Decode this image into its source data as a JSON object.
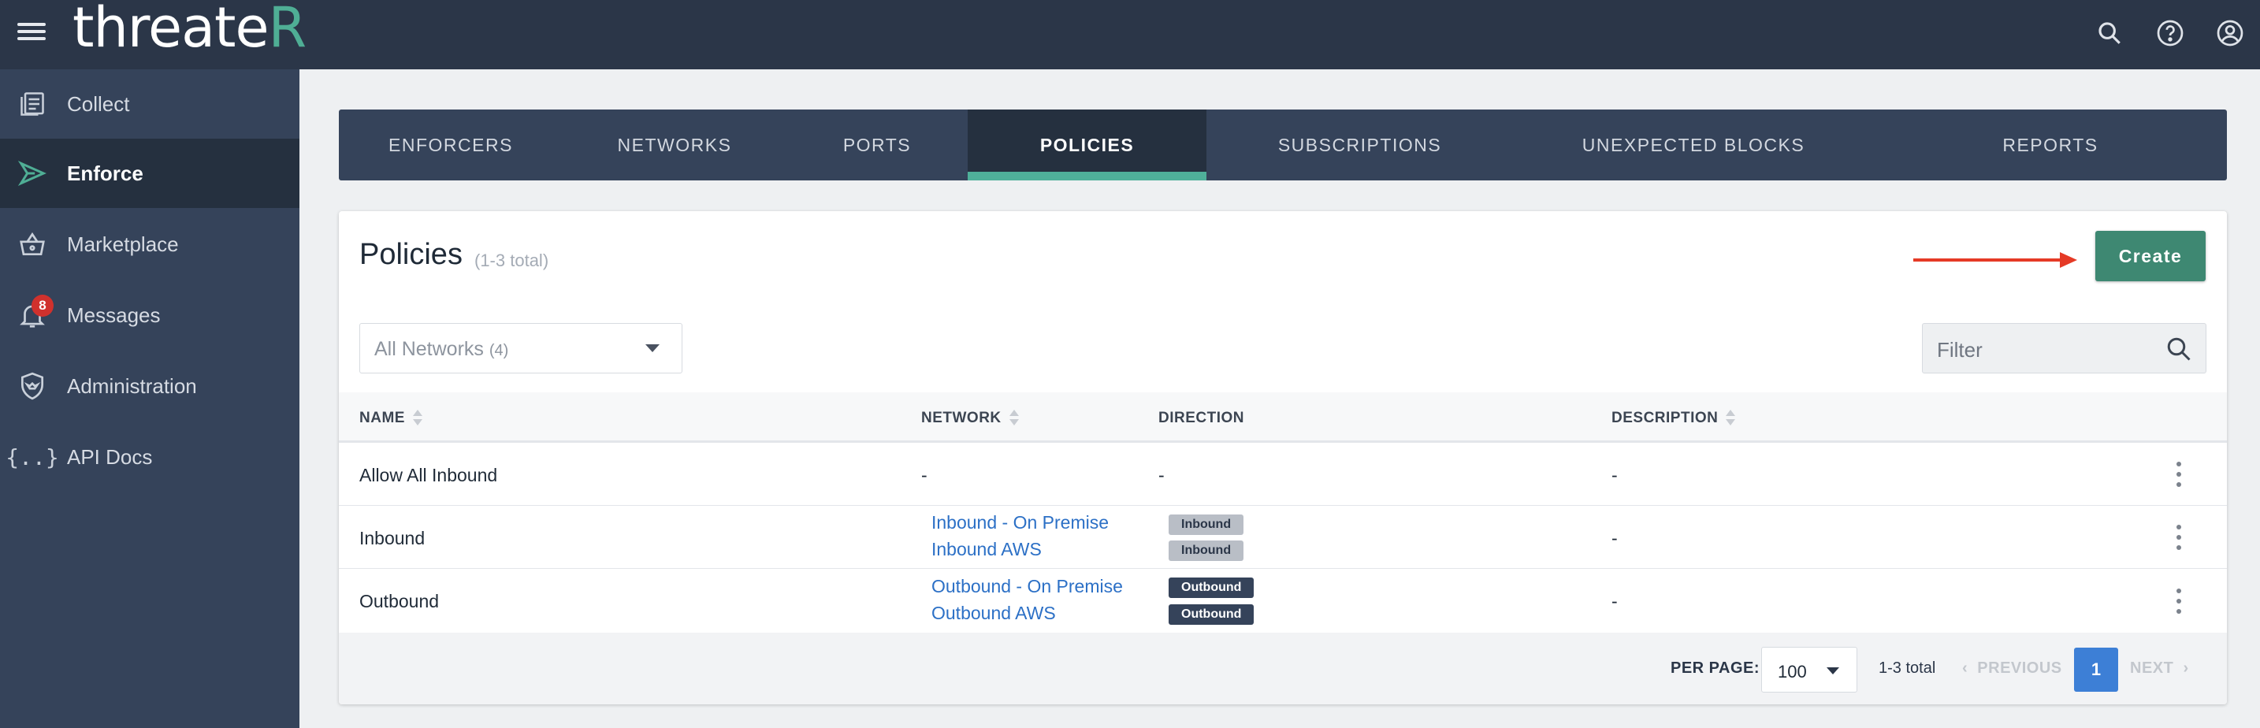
{
  "app": {
    "brand_prefix": "threate",
    "brand_suffix": "R",
    "brand_accent_color": "#4fae95",
    "header_icons": [
      "search-icon",
      "help-icon",
      "account-icon"
    ]
  },
  "sidebar": {
    "items": [
      {
        "label": "Collect",
        "icon": "collect-icon",
        "active": false
      },
      {
        "label": "Enforce",
        "icon": "enforce-icon",
        "active": true
      },
      {
        "label": "Marketplace",
        "icon": "basket-icon",
        "active": false
      },
      {
        "label": "Messages",
        "icon": "bell-icon",
        "active": false,
        "badge": "8"
      },
      {
        "label": "Administration",
        "icon": "shield-icon",
        "active": false
      },
      {
        "label": "API Docs",
        "icon": "braces-icon",
        "active": false
      }
    ]
  },
  "tabs": [
    {
      "label": "ENFORCERS",
      "active": false
    },
    {
      "label": "NETWORKS",
      "active": false
    },
    {
      "label": "PORTS",
      "active": false
    },
    {
      "label": "POLICIES",
      "active": true
    },
    {
      "label": "SUBSCRIPTIONS",
      "active": false
    },
    {
      "label": "UNEXPECTED BLOCKS",
      "active": false
    },
    {
      "label": "REPORTS",
      "active": false
    }
  ],
  "card": {
    "title": "Policies",
    "count": "(1-3 total)",
    "create_label": "Create",
    "network_select": {
      "label": "All Networks",
      "count": "(4)"
    },
    "filter_placeholder": "Filter"
  },
  "table": {
    "columns": [
      "NAME",
      "NETWORK",
      "DIRECTION",
      "DESCRIPTION"
    ],
    "rows": [
      {
        "name": "Allow All Inbound",
        "network": "-",
        "direction": "-",
        "description": "-"
      },
      {
        "name": "Inbound",
        "networks": [
          "Inbound - On Premise",
          "Inbound AWS"
        ],
        "directions": [
          "Inbound",
          "Inbound"
        ],
        "description": "-"
      },
      {
        "name": "Outbound",
        "networks": [
          "Outbound - On Premise",
          "Outbound AWS"
        ],
        "directions": [
          "Outbound",
          "Outbound"
        ],
        "description": "-"
      }
    ]
  },
  "pagination": {
    "per_page_label": "PER PAGE:",
    "per_page_value": "100",
    "total": "1-3 total",
    "previous": "PREVIOUS",
    "current_page": "1",
    "next": "NEXT"
  },
  "colors": {
    "topbar": "#2b3648",
    "sidebar": "#35435a",
    "tab_indicator": "#4fb09a",
    "create_button": "#3e8872",
    "arrow": "#e53a26",
    "link": "#2c70c6",
    "page_active": "#3d7fd6"
  }
}
